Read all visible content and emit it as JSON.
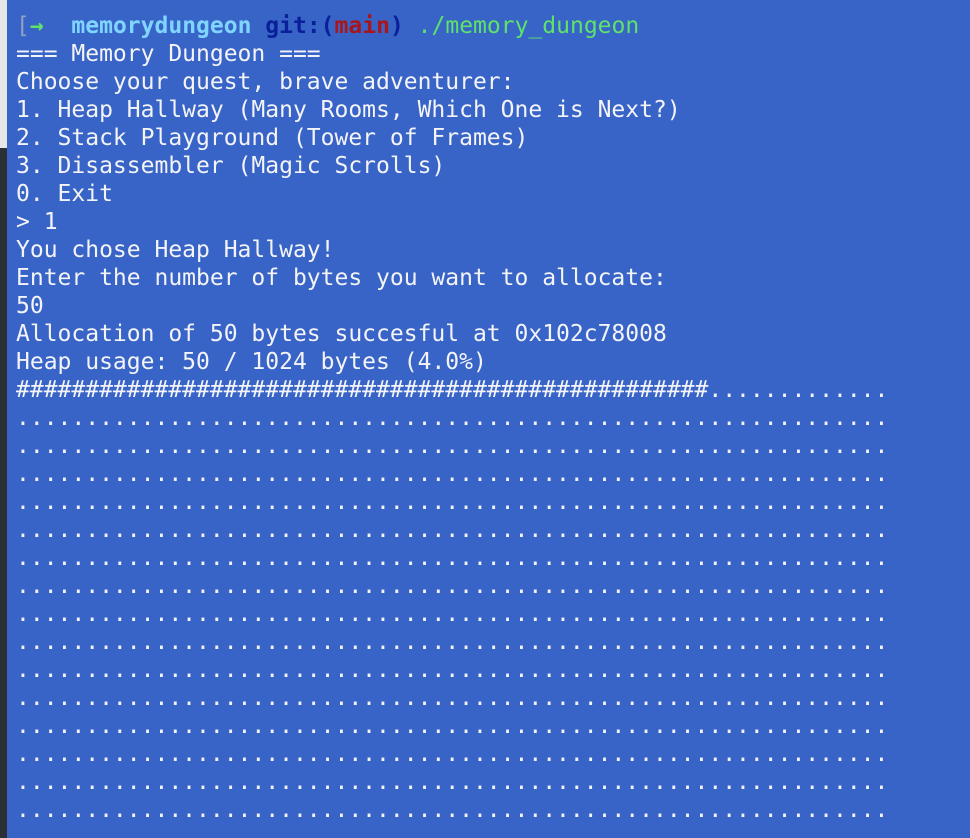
{
  "prompt": {
    "bracket": "[",
    "arrow": "→",
    "cwd": "memorydungeon",
    "git_prefix": "git:(",
    "branch": "main",
    "git_suffix": ")",
    "command": "./memory_dungeon"
  },
  "output_lines": [
    "=== Memory Dungeon ===",
    "Choose your quest, brave adventurer:",
    "1. Heap Hallway (Many Rooms, Which One is Next?)",
    "2. Stack Playground (Tower of Frames)",
    "3. Disassembler (Magic Scrolls)",
    "0. Exit",
    "> 1",
    "You chose Heap Hallway!",
    "Enter the number of bytes you want to allocate:",
    "50",
    "Allocation of 50 bytes succesful at 0x102c78008",
    "Heap usage: 50 / 1024 bytes (4.0%)"
  ],
  "heap_map": {
    "used_row": "##################################################.............",
    "free_row": "...............................................................",
    "free_row_count": 15
  },
  "colors": {
    "terminal_bg": "#3764c6",
    "text": "#f4f4f8",
    "arrow": "#5fe26b",
    "cwd": "#7fd5ff",
    "git": "#0a1f9a",
    "branch": "#a8161c",
    "command": "#5fe26b"
  }
}
